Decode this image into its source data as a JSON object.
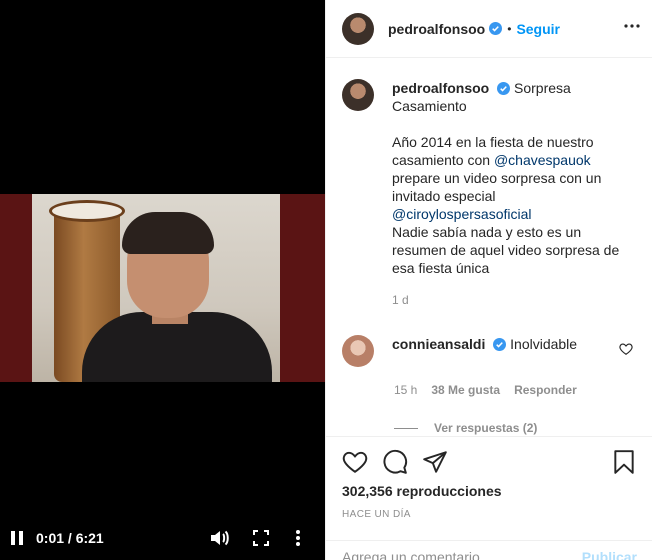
{
  "video": {
    "time": "0:01 / 6:21"
  },
  "post": {
    "username": "pedroalfonsoo",
    "dot": "•",
    "follow_label": "Seguir",
    "caption": {
      "first_line": "Sorpresa",
      "second_line": "Casamiento",
      "para1_a": "Año 2014 en la fiesta de nuestro",
      "para1_b": "casamiento con",
      "mention1": "@chavespauok",
      "para1_c": "prepare un video sorpresa con un",
      "para1_d": "invitado especial",
      "mention2": "@ciroylospersasoficial",
      "para2_a": "Nadie sabía nada y esto es un",
      "para2_b": "resumen de aquel video sorpresa de",
      "para2_c": "esa fiesta única",
      "age": "1 d"
    },
    "comment": {
      "username": "connieansaldi",
      "text": "Inolvidable",
      "age": "15 h",
      "likes": "38 Me gusta",
      "reply_label": "Responder",
      "view_replies": "Ver respuestas (2)"
    },
    "views": "302,356 reproducciones",
    "timestamp": "HACE UN DÍA",
    "add_comment_placeholder": "Agrega un comentario...",
    "publish_label": "Publicar"
  },
  "colors": {
    "accent": "#0095f6",
    "verified": "#3897f0",
    "text": "#262626",
    "muted": "#8e8e8e",
    "publish_disabled": "#b2dffc"
  },
  "icons": [
    "pause-icon",
    "volume-icon",
    "fullscreen-icon",
    "more-vertical-icon",
    "verified-icon",
    "more-horizontal-icon",
    "heart-icon",
    "comment-icon",
    "share-icon",
    "bookmark-icon"
  ]
}
